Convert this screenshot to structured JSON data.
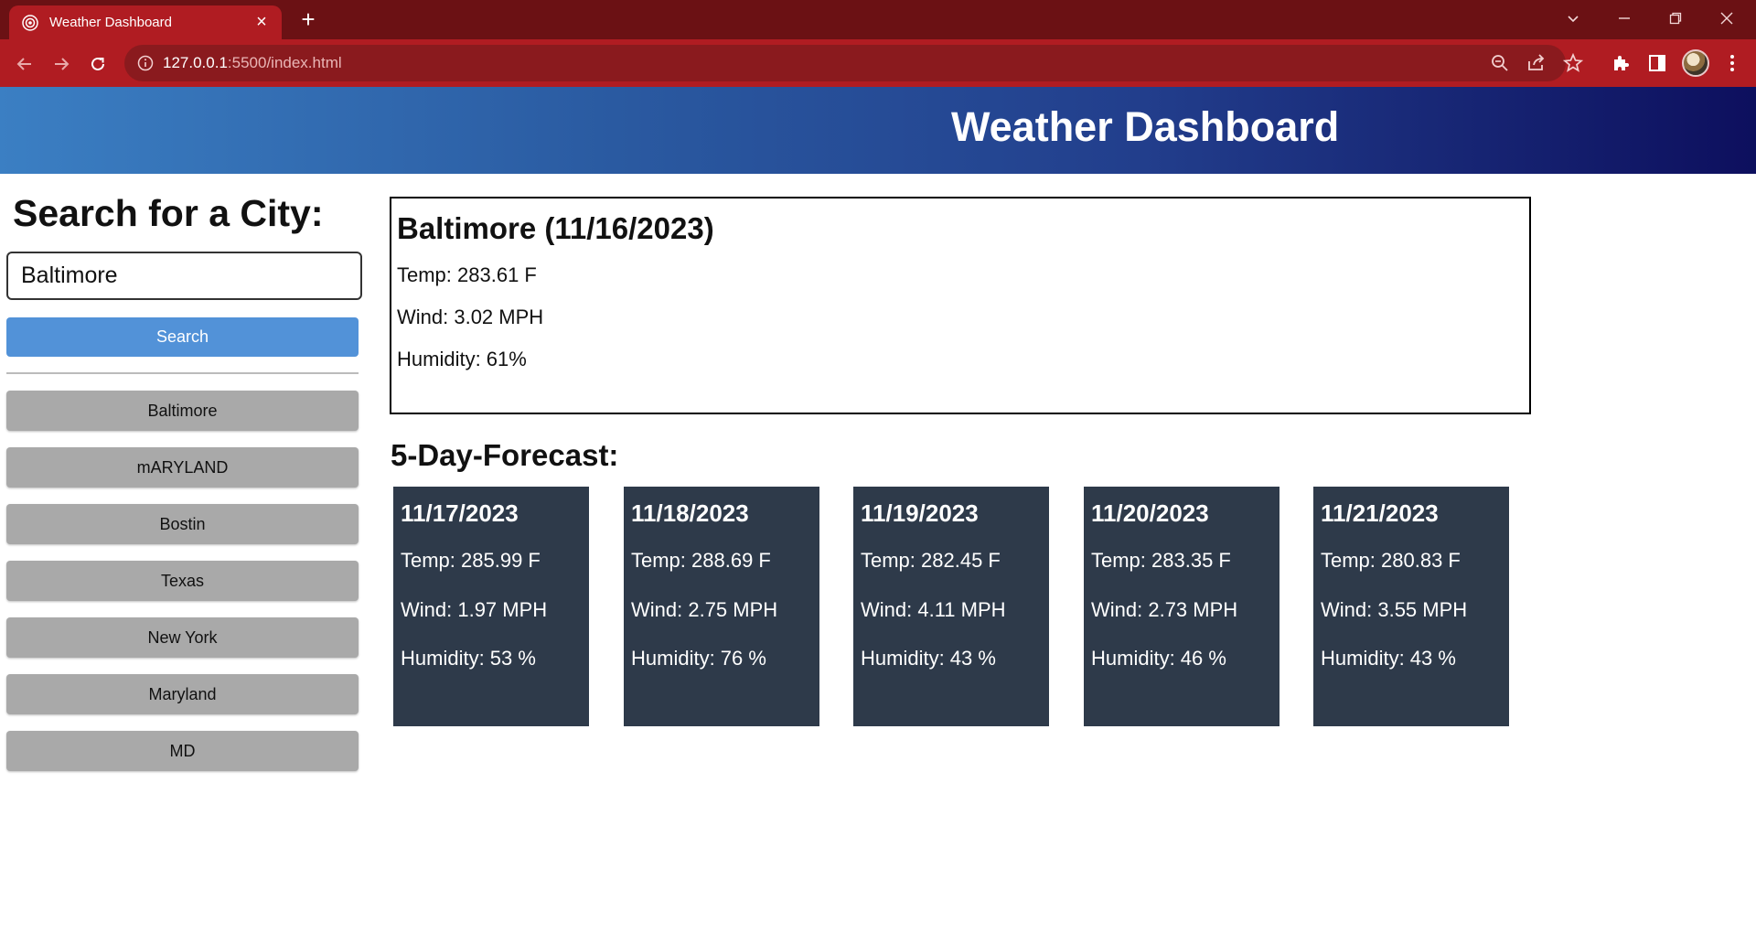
{
  "browser": {
    "tab_title": "Weather Dashboard",
    "url_host": "127.0.0.1",
    "url_rest": ":5500/index.html"
  },
  "header": {
    "title": "Weather Dashboard"
  },
  "sidebar": {
    "heading": "Search for a City:",
    "search_value": "Baltimore",
    "search_button": "Search",
    "history": [
      "Baltimore",
      "mARYLAND",
      "Bostin",
      "Texas",
      "New York",
      "Maryland",
      "MD"
    ]
  },
  "current": {
    "title": "Baltimore (11/16/2023)",
    "temp": "Temp: 283.61 F",
    "wind": "Wind: 3.02 MPH",
    "humidity": "Humidity: 61%"
  },
  "forecast": {
    "heading": "5-Day-Forecast:",
    "days": [
      {
        "date": "11/17/2023",
        "temp": "Temp: 285.99 F",
        "wind": "Wind: 1.97 MPH",
        "humidity": "Humidity: 53 %"
      },
      {
        "date": "11/18/2023",
        "temp": "Temp: 288.69 F",
        "wind": "Wind: 2.75 MPH",
        "humidity": "Humidity: 76 %"
      },
      {
        "date": "11/19/2023",
        "temp": "Temp: 282.45 F",
        "wind": "Wind: 4.11 MPH",
        "humidity": "Humidity: 43 %"
      },
      {
        "date": "11/20/2023",
        "temp": "Temp: 283.35 F",
        "wind": "Wind: 2.73 MPH",
        "humidity": "Humidity: 46 %"
      },
      {
        "date": "11/21/2023",
        "temp": "Temp: 280.83 F",
        "wind": "Wind: 3.55 MPH",
        "humidity": "Humidity: 43 %"
      }
    ]
  },
  "colors": {
    "tabstrip": "#6b1114",
    "toolbar": "#b01c22",
    "search_button": "#5292d8",
    "history_button": "#a9a9a9",
    "forecast_card": "#2e3a4a"
  }
}
